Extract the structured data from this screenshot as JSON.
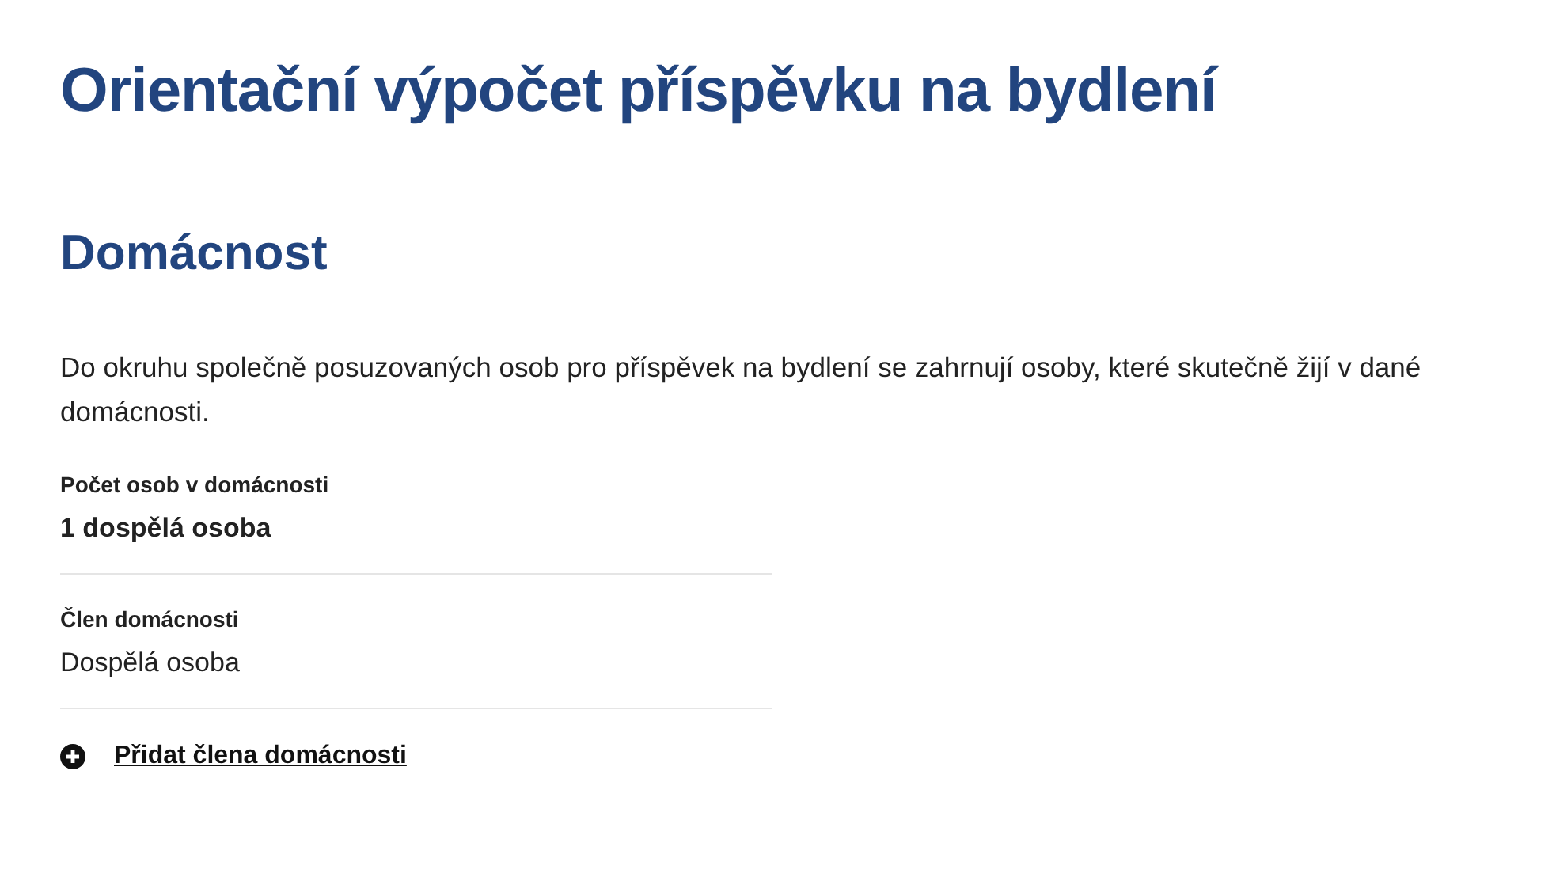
{
  "title": "Orientační výpočet příspěvku na bydlení",
  "section": {
    "heading": "Domácnost",
    "description": "Do okruhu společně posuzovaných osob pro příspěvek na bydlení se zahrnují osoby, které skutečně žijí v dané domácnosti.",
    "fields": [
      {
        "label": "Počet osob v domácnosti",
        "value": "1 dospělá osoba",
        "emphasis": true
      },
      {
        "label": "Člen domácnosti",
        "value": "Dospělá osoba",
        "emphasis": false
      }
    ],
    "add_link": "Přidat člena domácnosti"
  }
}
